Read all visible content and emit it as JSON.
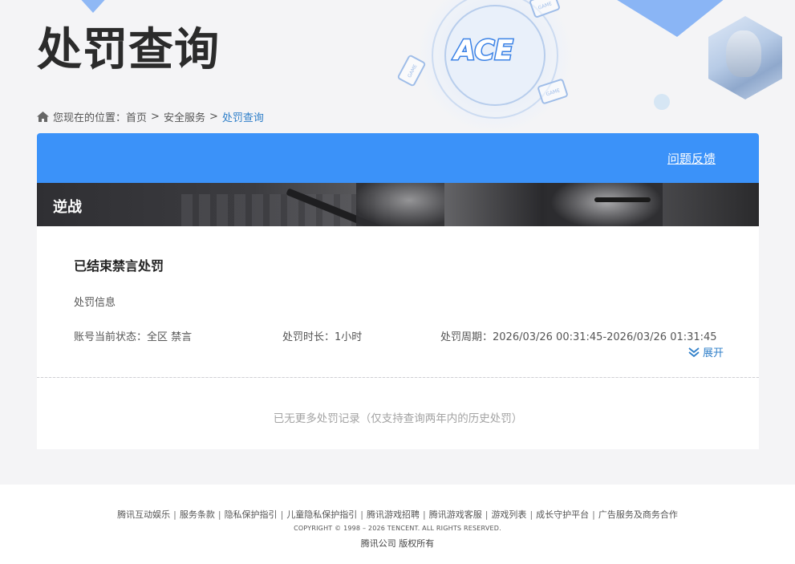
{
  "header": {
    "page_title": "处罚查询",
    "logo_text": "ACE",
    "deco_card_text": "GAME"
  },
  "breadcrumb": {
    "prefix": "您现在的位置：",
    "items": [
      "首页",
      "安全服务",
      "处罚查询"
    ],
    "separator": ">"
  },
  "panel": {
    "feedback_label": "问题反馈",
    "game_name": "逆战"
  },
  "record": {
    "title": "已结束禁言处罚",
    "section_label": "处罚信息",
    "status": "账号当前状态：全区 禁言",
    "duration": "处罚时长：1小时",
    "period": "处罚周期：2026/03/26 00:31:45-2026/03/26 01:31:45",
    "expand_label": "展开"
  },
  "no_more_text": "已无更多处罚记录（仅支持查询两年内的历史处罚）",
  "footer": {
    "links": [
      "腾讯互动娱乐",
      "服务条款",
      "隐私保护指引",
      "儿童隐私保护指引",
      "腾讯游戏招聘",
      "腾讯游戏客服",
      "游戏列表",
      "成长守护平台",
      "广告服务及商务合作"
    ],
    "copyright": "COPYRIGHT © 1998 – 2026 TENCENT. ALL RIGHTS RESERVED.",
    "company": "腾讯公司 版权所有"
  },
  "colors": {
    "accent": "#3b92f9",
    "link": "#2f7fc9",
    "title": "#2b2b2b",
    "muted": "#a3a3a3"
  },
  "icons": [
    "home-icon",
    "chevron-double-down-icon"
  ]
}
